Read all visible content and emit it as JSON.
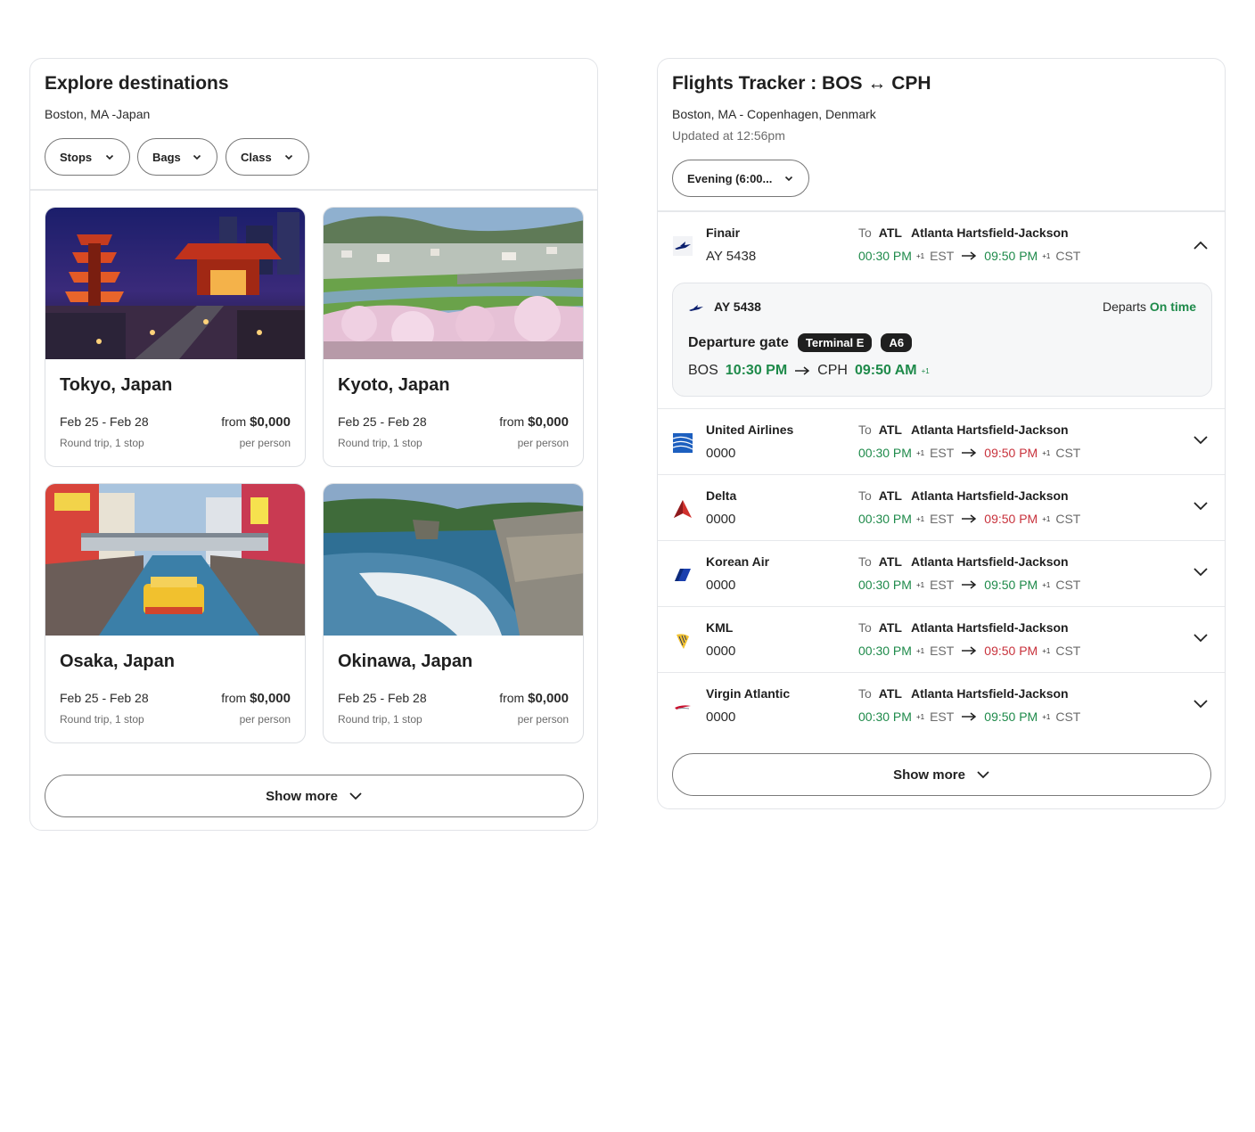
{
  "explore": {
    "title": "Explore destinations",
    "subtitle": "Boston, MA -Japan",
    "filters": [
      "Stops",
      "Bags",
      "Class"
    ],
    "cards": [
      {
        "city": "Tokyo, Japan",
        "dates": "Feb 25 - Feb 28",
        "trip": "Round trip, 1 stop",
        "from": "from",
        "price": "$0,000",
        "per": "per person"
      },
      {
        "city": "Kyoto, Japan",
        "dates": "Feb 25 - Feb 28",
        "trip": "Round trip, 1 stop",
        "from": "from",
        "price": "$0,000",
        "per": "per person"
      },
      {
        "city": "Osaka, Japan",
        "dates": "Feb 25 - Feb 28",
        "trip": "Round trip, 1 stop",
        "from": "from",
        "price": "$0,000",
        "per": "per person"
      },
      {
        "city": "Okinawa, Japan",
        "dates": "Feb 25 - Feb 28",
        "trip": "Round trip, 1 stop",
        "from": "from",
        "price": "$0,000",
        "per": "per person"
      }
    ],
    "show_more": "Show more"
  },
  "flights": {
    "title": "Flights Tracker : BOS ↔ CPH",
    "subtitle": "Boston, MA - Copenhagen, Denmark",
    "updated": "Updated at 12:56pm",
    "time_filter": "Evening (6:00...",
    "detail": {
      "flight_no": "AY 5438",
      "departs_label": "Departs",
      "departs_status": "On time",
      "gate_label": "Departure gate",
      "terminal": "Terminal E",
      "gate": "A6",
      "origin": "BOS",
      "depart_time": "10:30 PM",
      "destination": "CPH",
      "arrive_time": "09:50 AM",
      "day_offset": "+1"
    },
    "rows": [
      {
        "airline": "Finair",
        "flight_no": "AY 5438",
        "to": "To",
        "code": "ATL",
        "airport": "Atlanta Hartsfield-Jackson",
        "dep": "00:30 PM",
        "dep_sup": "+1",
        "dep_tz": "EST",
        "arr": "09:50 PM",
        "arr_sup": "+1",
        "arr_tz": "CST",
        "arr_status": "green",
        "expanded": true,
        "logo_color": "#0b1f6e"
      },
      {
        "airline": "United Airlines",
        "flight_no": "0000",
        "to": "To",
        "code": "ATL",
        "airport": "Atlanta Hartsfield-Jackson",
        "dep": "00:30 PM",
        "dep_sup": "+1",
        "dep_tz": "EST",
        "arr": "09:50 PM",
        "arr_sup": "+1",
        "arr_tz": "CST",
        "arr_status": "red",
        "expanded": false,
        "logo_color": "#1d5fbf"
      },
      {
        "airline": "Delta",
        "flight_no": "0000",
        "to": "To",
        "code": "ATL",
        "airport": "Atlanta Hartsfield-Jackson",
        "dep": "00:30 PM",
        "dep_sup": "+1",
        "dep_tz": "EST",
        "arr": "09:50 PM",
        "arr_sup": "+1",
        "arr_tz": "CST",
        "arr_status": "red",
        "expanded": false,
        "logo_color": "#d0312d"
      },
      {
        "airline": "Korean Air",
        "flight_no": "0000",
        "to": "To",
        "code": "ATL",
        "airport": "Atlanta Hartsfield-Jackson",
        "dep": "00:30 PM",
        "dep_sup": "+1",
        "dep_tz": "EST",
        "arr": "09:50 PM",
        "arr_sup": "+1",
        "arr_tz": "CST",
        "arr_status": "green",
        "expanded": false,
        "logo_color": "#1a3fae"
      },
      {
        "airline": "KML",
        "flight_no": "0000",
        "to": "To",
        "code": "ATL",
        "airport": "Atlanta Hartsfield-Jackson",
        "dep": "00:30 PM",
        "dep_sup": "+1",
        "dep_tz": "EST",
        "arr": "09:50 PM",
        "arr_sup": "+1",
        "arr_tz": "CST",
        "arr_status": "red",
        "expanded": false,
        "logo_color": "#f2c230"
      },
      {
        "airline": "Virgin Atlantic",
        "flight_no": "0000",
        "to": "To",
        "code": "ATL",
        "airport": "Atlanta Hartsfield-Jackson",
        "dep": "00:30 PM",
        "dep_sup": "+1",
        "dep_tz": "EST",
        "arr": "09:50 PM",
        "arr_sup": "+1",
        "arr_tz": "CST",
        "arr_status": "green",
        "expanded": false,
        "logo_color": "#c8102e"
      }
    ],
    "show_more": "Show more"
  },
  "colors": {
    "on_time": "#1e8a4a",
    "delayed": "#c8323c",
    "border": "#e2e4e8"
  }
}
